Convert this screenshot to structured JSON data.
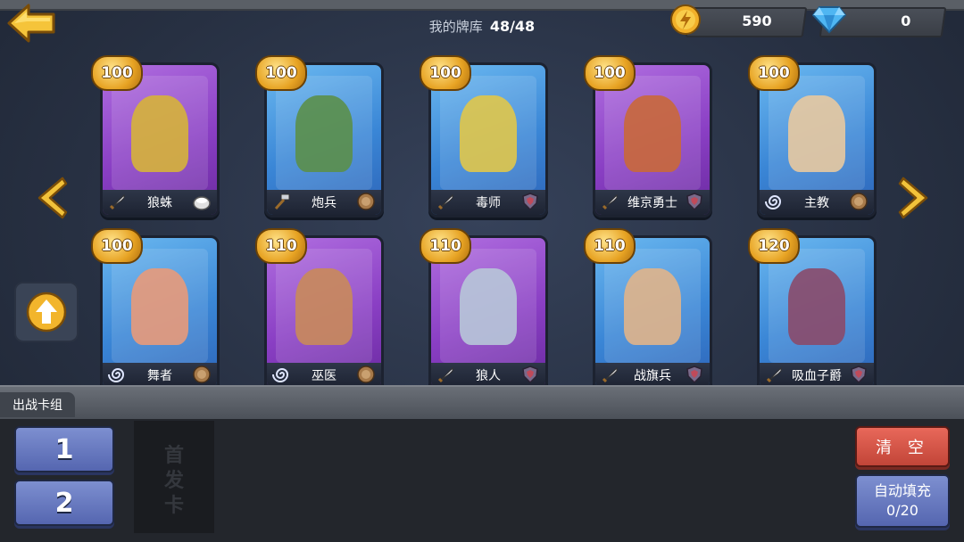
{
  "header": {
    "title_label": "我的牌库",
    "title_count": "48/48",
    "coins": "590",
    "gems": "0"
  },
  "cards": [
    {
      "name": "狼蛛",
      "cost": "100",
      "rarity": "purple",
      "type_icon": "sword-icon",
      "badge_icon": "stone-icon",
      "art_color": "#d6b33a"
    },
    {
      "name": "炮兵",
      "cost": "100",
      "rarity": "blue",
      "type_icon": "hammer-icon",
      "badge_icon": "wood-shield-icon",
      "art_color": "#5b8f4a"
    },
    {
      "name": "毒师",
      "cost": "100",
      "rarity": "blue",
      "type_icon": "sword-icon",
      "badge_icon": "purple-shield-icon",
      "art_color": "#e0c64a"
    },
    {
      "name": "维京勇士",
      "cost": "100",
      "rarity": "purple",
      "type_icon": "sword-icon",
      "badge_icon": "purple-shield-icon",
      "art_color": "#c9683a"
    },
    {
      "name": "主教",
      "cost": "100",
      "rarity": "blue",
      "type_icon": "spiral-icon",
      "badge_icon": "wood-shield-icon",
      "art_color": "#e8c9a0"
    },
    {
      "name": "舞者",
      "cost": "100",
      "rarity": "blue",
      "type_icon": "spiral-icon",
      "badge_icon": "wood-shield-icon",
      "art_color": "#e89a7a"
    },
    {
      "name": "巫医",
      "cost": "110",
      "rarity": "purple",
      "type_icon": "spiral-icon",
      "badge_icon": "wood-shield-icon",
      "art_color": "#c98a5a"
    },
    {
      "name": "狼人",
      "cost": "110",
      "rarity": "purple",
      "type_icon": "sword-icon",
      "badge_icon": "purple-shield-icon",
      "art_color": "#b7c7d8"
    },
    {
      "name": "战旗兵",
      "cost": "110",
      "rarity": "blue",
      "type_icon": "sword-icon",
      "badge_icon": "purple-shield-icon",
      "art_color": "#e0b48a"
    },
    {
      "name": "吸血子爵",
      "cost": "120",
      "rarity": "blue",
      "type_icon": "sword-icon",
      "badge_icon": "purple-shield-icon",
      "art_color": "#8a4a6a"
    }
  ],
  "deck": {
    "label": "出战卡组",
    "deck_buttons": [
      "1",
      "2"
    ],
    "slot_placeholder": [
      "首",
      "发",
      "卡"
    ],
    "clear_label": "清 空",
    "auto_fill_label": "自动填充",
    "auto_fill_count": "0/20"
  },
  "colors": {
    "card_purple": "#8a3fc4",
    "card_blue": "#3a86d6",
    "cost_gold": "#e7a323",
    "clear_red": "#c24538",
    "button_blue": "#5566b0"
  }
}
